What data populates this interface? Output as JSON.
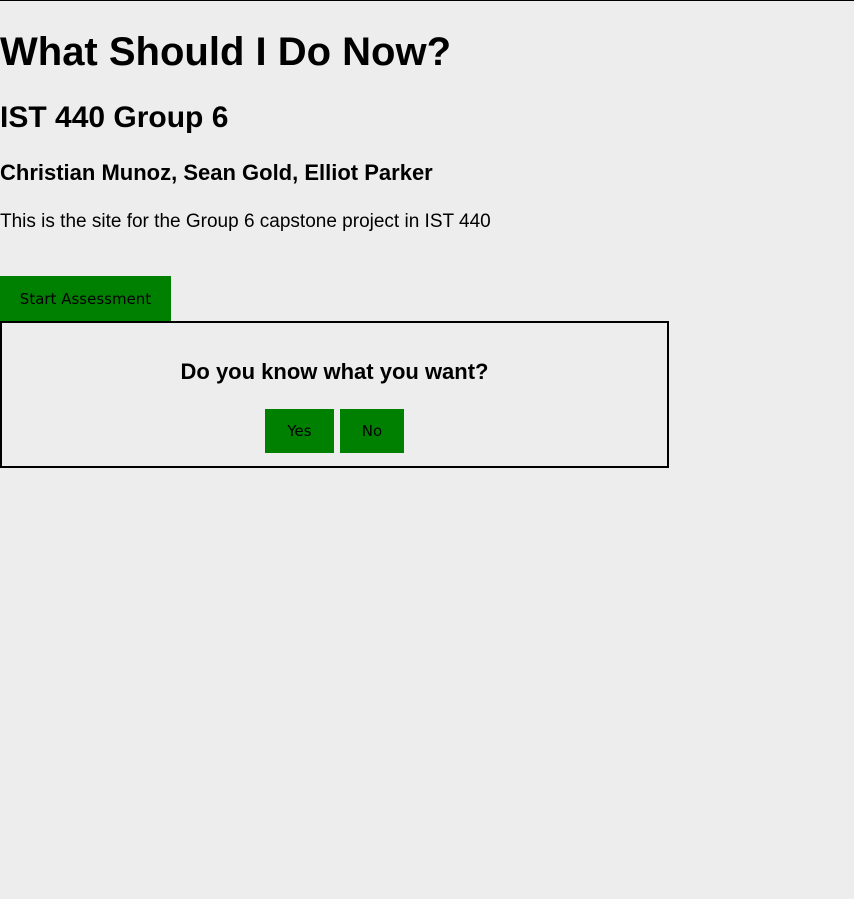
{
  "header": {
    "title": "What Should I Do Now?",
    "group": "IST 440 Group 6",
    "members": "Christian Munoz, Sean Gold, Elliot Parker",
    "description": "This is the site for the Group 6 capstone project in IST 440"
  },
  "assessment": {
    "start_label": "Start Assessment",
    "question": "Do you know what you want?",
    "yes_label": "Yes",
    "no_label": "No"
  },
  "colors": {
    "background": "#ededed",
    "button": "#008000",
    "text": "#000000"
  }
}
